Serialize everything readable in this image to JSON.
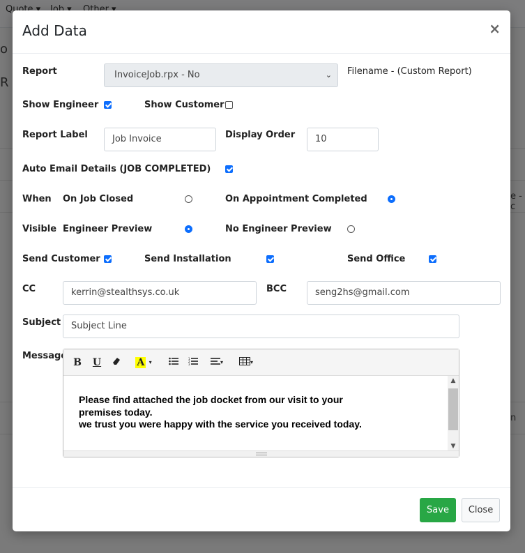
{
  "background": {
    "nav_quote": "Quote ▾",
    "nav_job": "Job ▾",
    "nav_other": "Other ▾",
    "partial_text_1": "o",
    "partial_text_2": "R U",
    "side_text_1": "e - c",
    "side_text_2": "n"
  },
  "modal": {
    "title": "Add Data",
    "close_glyph": "×"
  },
  "form": {
    "report_label": "Report",
    "report_value": "InvoiceJob.rpx - No",
    "filename_text": "Filename - (Custom Report)",
    "show_engineer_label": "Show Engineer",
    "show_engineer_checked": true,
    "show_customer_label": "Show Customer",
    "show_customer_checked": false,
    "report_label_label": "Report Label",
    "report_label_value": "Job Invoice",
    "display_order_label": "Display Order",
    "display_order_value": "10",
    "auto_email_label": "Auto Email Details (JOB COMPLETED)",
    "auto_email_checked": true,
    "when_label": "When",
    "when_option_1": "On Job Closed",
    "when_option_2": "On Appointment Completed",
    "when_selected": "On Appointment Completed",
    "visible_label": "Visible",
    "visible_option_1": "Engineer Preview",
    "visible_option_2": "No Engineer Preview",
    "visible_selected": "Engineer Preview",
    "send_customer_label": "Send Customer",
    "send_customer_checked": true,
    "send_installation_label": "Send Installation",
    "send_installation_checked": true,
    "send_office_label": "Send Office",
    "send_office_checked": true,
    "cc_label": "CC",
    "cc_value": "kerrin@stealthsys.co.uk",
    "bcc_label": "BCC",
    "bcc_value": "seng2hs@gmail.com",
    "subject_label": "Subject",
    "subject_value": "Subject Line",
    "message_label": "Message"
  },
  "editor": {
    "tools": [
      "bold-icon",
      "underline-icon",
      "eraser-icon",
      "highlight-icon",
      "bulleted-list-icon",
      "numbered-list-icon",
      "align-icon",
      "table-icon"
    ],
    "message_lines": [
      "Please find attached the job docket from our visit to your",
      "premises today.",
      "we trust you were happy with the service you received today."
    ]
  },
  "footer": {
    "save_label": "Save",
    "close_label": "Close"
  },
  "colors": {
    "accent": "#0d6efd",
    "save_button": "#28a745"
  }
}
